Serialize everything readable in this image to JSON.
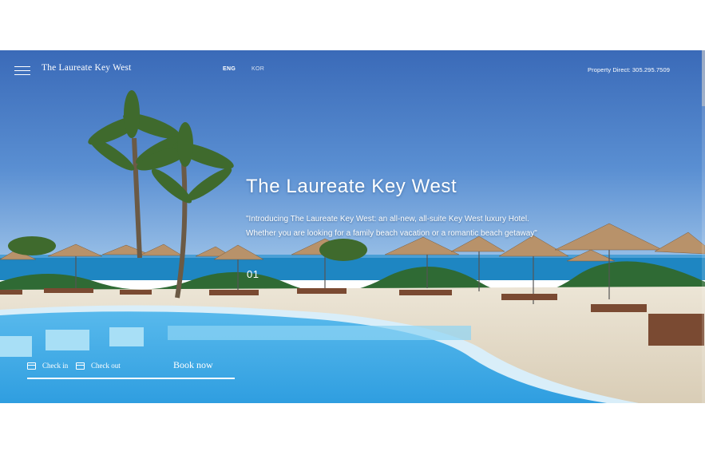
{
  "header": {
    "brand": "The Laureate Key West",
    "languages": {
      "eng": "ENG",
      "kor": "KOR"
    },
    "phone": "Property Direct: 305.295.7509"
  },
  "hero": {
    "title": "The Laureate Key West",
    "description": "\"Introducing The Laureate Key West: an all-new, all-suite Key West luxury Hotel. Whether you are looking for a family beach vacation or a romantic beach getaway\"",
    "slide_number": "01"
  },
  "booking": {
    "check_in": "Check in",
    "check_out": "Check out",
    "book_now": "Book now"
  },
  "icons": {
    "menu": "hamburger-menu-icon",
    "calendar": "calendar-icon"
  },
  "colors": {
    "sky_top": "#3a6fbd",
    "sea": "#1f8fc4",
    "pool": "#5bc3ef",
    "sand": "#e6ddcc",
    "text": "#ffffff"
  }
}
